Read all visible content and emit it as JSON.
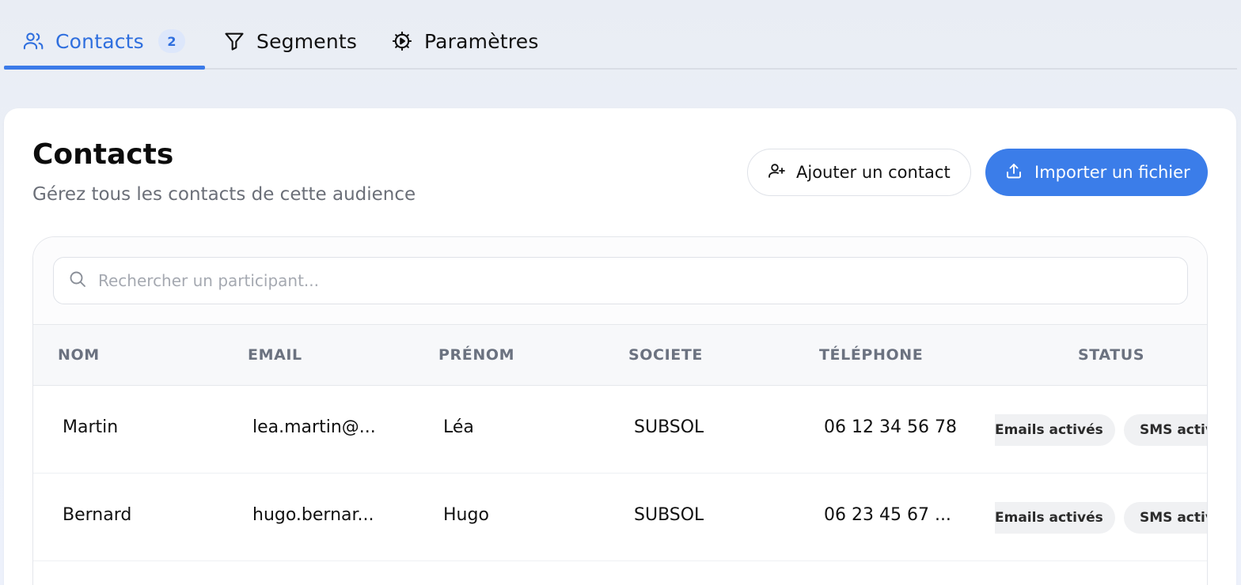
{
  "tabs": [
    {
      "label": "Contacts",
      "badge": "2"
    },
    {
      "label": "Segments"
    },
    {
      "label": "Paramètres"
    }
  ],
  "header": {
    "title": "Contacts",
    "subtitle": "Gérez tous les contacts de cette audience",
    "add_label": "Ajouter un contact",
    "import_label": "Importer un fichier"
  },
  "search": {
    "placeholder": "Rechercher un participant..."
  },
  "table": {
    "columns": [
      "NOM",
      "EMAIL",
      "PRÉNOM",
      "SOCIETE",
      "TÉLÉPHONE",
      "STATUS"
    ],
    "rows": [
      {
        "nom": "Martin",
        "email": "lea.martin@...",
        "prenom": "Léa",
        "societe": "SUBSOL",
        "telephone": "06 12 34 56 78",
        "status_email": "Emails activés",
        "status_sms": "SMS activ"
      },
      {
        "nom": "Bernard",
        "email": "hugo.bernar...",
        "prenom": "Hugo",
        "societe": "SUBSOL",
        "telephone": "06 23 45 67 ...",
        "status_email": "Emails activés",
        "status_sms": "SMS activ"
      }
    ]
  },
  "colors": {
    "accent": "#3b7de9",
    "active_tab": "#2f6fde",
    "badge_bg": "#dde7fb"
  },
  "icons": {
    "contacts_tab": "users-icon",
    "segments_tab": "filter-icon",
    "params_tab": "gear-icon",
    "add_button": "user-plus-icon",
    "import_button": "upload-icon",
    "search": "search-icon"
  }
}
